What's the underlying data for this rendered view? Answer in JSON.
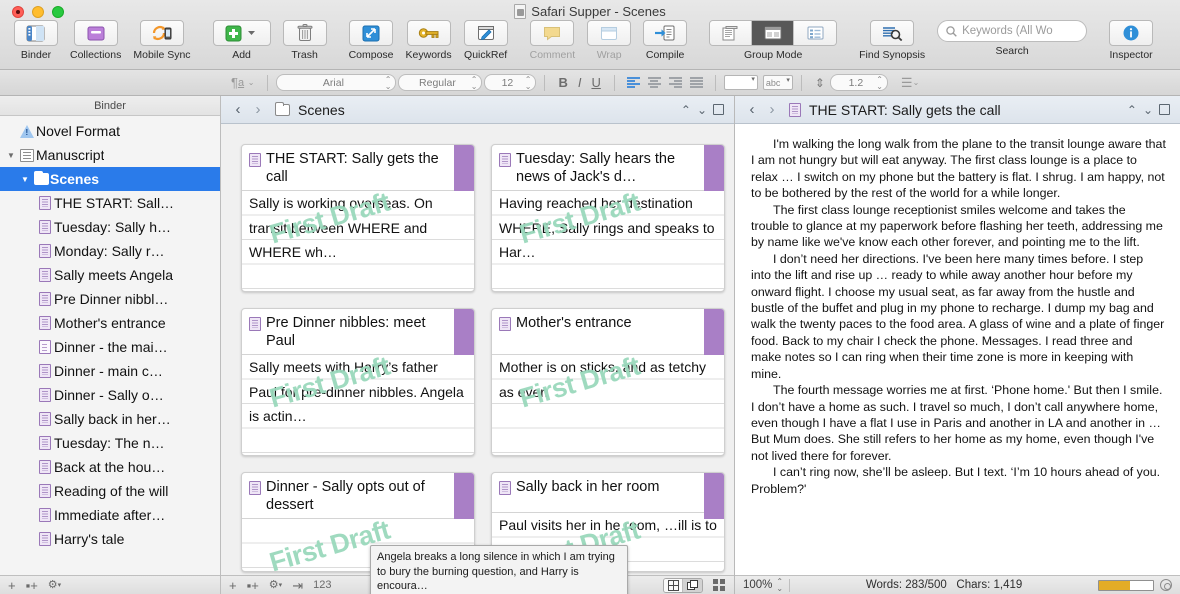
{
  "window": {
    "title": "Safari Supper - Scenes",
    "doc_icon": "document-icon"
  },
  "toolbar": {
    "items": [
      {
        "label": "Binder",
        "icon": "binder-icon"
      },
      {
        "label": "Collections",
        "icon": "collections-icon"
      },
      {
        "label": "Mobile Sync",
        "icon": "mobile-sync-icon"
      },
      {
        "label": "Add",
        "icon": "add-plus-icon"
      },
      {
        "label": "Trash",
        "icon": "trash-icon"
      },
      {
        "label": "Compose",
        "icon": "compose-icon"
      },
      {
        "label": "Keywords",
        "icon": "key-icon"
      },
      {
        "label": "QuickRef",
        "icon": "quickref-icon"
      },
      {
        "label": "Comment",
        "icon": "comment-icon",
        "disabled": true
      },
      {
        "label": "Wrap",
        "icon": "wrap-icon",
        "disabled": true
      },
      {
        "label": "Compile",
        "icon": "compile-icon"
      }
    ],
    "group_mode": {
      "label": "Group Mode",
      "options": [
        "scrivenings",
        "corkboard",
        "outliner"
      ],
      "selected": "corkboard"
    },
    "find_synopsis": {
      "label": "Find Synopsis",
      "icon": "find-synopsis-icon"
    },
    "search": {
      "label": "Search",
      "placeholder": "Keywords (All Wo",
      "icon": "search-icon"
    },
    "inspector": {
      "label": "Inspector",
      "icon": "info-icon"
    }
  },
  "formatbar": {
    "paragraph_style_icon": "paragraph-style-icon",
    "font_family": "Arial",
    "font_style": "Regular",
    "font_size": "12",
    "bold": "B",
    "italic": "I",
    "underline": "U",
    "highlight_icon": "highlight-color-icon",
    "spelling_label": "abc",
    "line_spacing": "1.2",
    "list_icon": "list-icon"
  },
  "binder": {
    "header": "Binder",
    "items": [
      {
        "label": "Novel Format",
        "icon": "warning-icon",
        "indent": 1,
        "twisty": ""
      },
      {
        "label": "Manuscript",
        "icon": "manuscript-icon",
        "indent": 1,
        "twisty": "▼"
      },
      {
        "label": "Scenes",
        "icon": "folder-icon",
        "indent": 2,
        "twisty": "▼",
        "selected": true
      },
      {
        "label": "THE START: Sall…",
        "icon": "card-icon",
        "indent": 3,
        "twisty": ""
      },
      {
        "label": "Tuesday: Sally h…",
        "icon": "card-icon",
        "indent": 3,
        "twisty": ""
      },
      {
        "label": "Monday: Sally r…",
        "icon": "card-icon",
        "indent": 3,
        "twisty": ""
      },
      {
        "label": "Sally meets Angela",
        "icon": "card-icon",
        "indent": 3,
        "twisty": ""
      },
      {
        "label": "Pre Dinner nibbl…",
        "icon": "card-icon",
        "indent": 3,
        "twisty": ""
      },
      {
        "label": "Mother's entrance",
        "icon": "card-icon",
        "indent": 3,
        "twisty": ""
      },
      {
        "label": "Dinner - the mai…",
        "icon": "page-icon",
        "indent": 3,
        "twisty": ""
      },
      {
        "label": "Dinner - main c…",
        "icon": "card-icon",
        "indent": 3,
        "twisty": ""
      },
      {
        "label": "Dinner - Sally o…",
        "icon": "card-icon",
        "indent": 3,
        "twisty": ""
      },
      {
        "label": "Sally back in her…",
        "icon": "card-icon",
        "indent": 3,
        "twisty": ""
      },
      {
        "label": "Tuesday: The n…",
        "icon": "card-icon",
        "indent": 3,
        "twisty": ""
      },
      {
        "label": "Back at the hou…",
        "icon": "card-icon",
        "indent": 3,
        "twisty": ""
      },
      {
        "label": "Reading of the will",
        "icon": "card-icon",
        "indent": 3,
        "twisty": ""
      },
      {
        "label": "Immediate after…",
        "icon": "card-icon",
        "indent": 3,
        "twisty": ""
      },
      {
        "label": "Harry's tale",
        "icon": "card-icon",
        "indent": 3,
        "twisty": ""
      }
    ],
    "footer": {
      "add": "+",
      "add_folder": "▪+",
      "gear": "⚙"
    }
  },
  "corkboard": {
    "header": {
      "back": "‹",
      "forward": "›",
      "icon": "folder-icon",
      "title": "Scenes",
      "up": "⌃",
      "down": "⌄",
      "split": "▫"
    },
    "watermark": "First Draft",
    "cards": [
      {
        "title": "THE START: Sally gets the call",
        "body": "Sally is working overseas. On transit between WHERE and WHERE wh…"
      },
      {
        "title": "Tuesday: Sally hears the news of Jack's d…",
        "body": "Having reached her destination WHERE, Sally rings and speaks to Har…"
      },
      {
        "title": "Pre Dinner nibbles: meet Paul",
        "body": "Sally meets with Harry’s father Paul for pre-dinner nibbles. Angela is actin…"
      },
      {
        "title": "Mother's entrance",
        "body": "Mother is on sticks, and as tetchy as ever."
      },
      {
        "title": "Dinner - Sally opts out of dessert",
        "body": ""
      },
      {
        "title": "Sally back in her room",
        "body": "Paul visits her in he room, …ill is to be"
      }
    ],
    "footer": {
      "add": "+",
      "add_folder": "▪+",
      "gear": "⚙",
      "export": "⇥",
      "count": "123"
    }
  },
  "tooltip": {
    "text": "Angela breaks a long silence in which I am trying to bury the burning question, and Harry is encoura…"
  },
  "editor": {
    "header": {
      "back": "‹",
      "forward": "›",
      "icon": "card-icon",
      "title": "THE START: Sally gets the call",
      "up": "⌃",
      "down": "⌄",
      "split": "▫"
    },
    "paragraphs": [
      "I'm walking the long walk from the plane to the transit lounge aware that I am not hungry but will eat anyway. The first class lounge is a place to relax … I switch on my phone but the battery is flat. I shrug. I am happy, not to be bothered by the rest of the world for a while longer.",
      "The first class lounge receptionist smiles  welcome and takes the trouble to glance at my paperwork before flashing her teeth, addressing me by name like we've know each other forever, and pointing me to the lift.",
      "I don’t need her directions. I've been here many times before. I step into the lift and rise up … ready to while away another hour before my onward flight. I choose my usual seat, as far away from the hustle and bustle of the buffet and plug in my phone to recharge. I dump my bag and walk the twenty paces to the food area. A glass of wine and a plate of finger food. Back to my chair I check the phone. Messages. I read three and make notes so I can ring when their time zone is more in keeping with mine.",
      "The fourth message worries me at first. ‘Phone home.' But then I smile. I don’t have a home as such. I travel so much, I don’t call anywhere home, even though I have a flat I use in Paris and another in LA and another in … But Mum does. She still refers to her home as my home, even though I've not lived there for forever.",
      "I can’t ring now, she’ll be asleep. But I text. ‘I’m 10 hours ahead of you. Problem?'"
    ],
    "footer": {
      "zoom": "100%",
      "words": "Words: 283/500",
      "chars": "Chars: 1,419",
      "progress_pct": 57,
      "target_icon": "target-icon"
    }
  },
  "colors": {
    "selection": "#2a7bea",
    "card_stripe": "#a97fc6",
    "watermark": "#9ad9bc",
    "progress": "#e3ac26"
  }
}
